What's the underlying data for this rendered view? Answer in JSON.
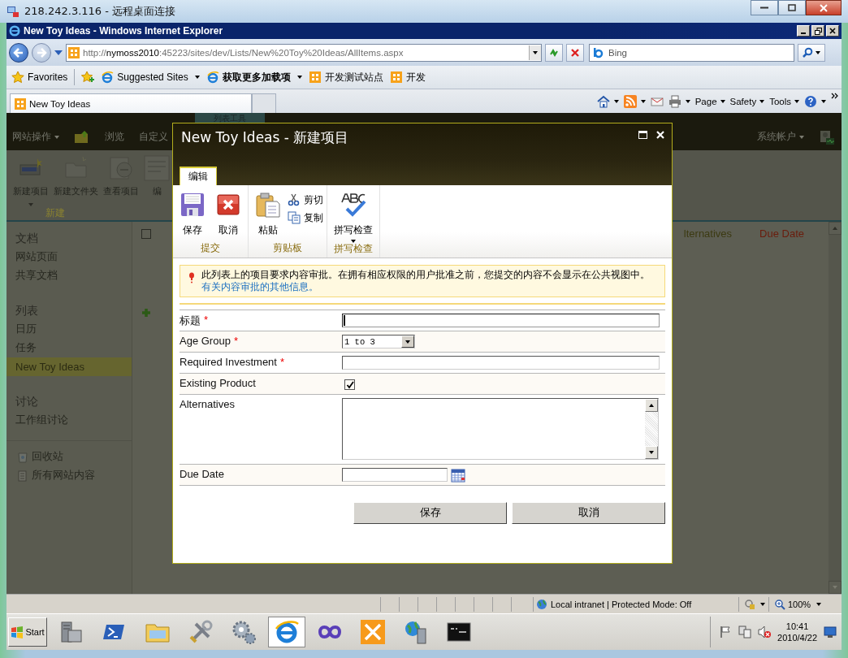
{
  "remote_window": {
    "title": "218.242.3.116 - 远程桌面连接"
  },
  "browser": {
    "title": "New Toy Ideas - Windows Internet Explorer",
    "address": {
      "prefix": "http://",
      "host": "nymoss2010",
      "path": ":45223/sites/dev/Lists/New%20Toy%20Ideas/AllItems.aspx"
    },
    "search": {
      "placeholder": "Bing"
    },
    "favorites": {
      "label": "Favorites"
    },
    "favorites_links": [
      {
        "label": "Suggested Sites",
        "kind": "ie",
        "dropdown": true,
        "bold": false
      },
      {
        "label": "获取更多加载项",
        "kind": "ie",
        "dropdown": true,
        "bold": true
      },
      {
        "label": "开发测试站点",
        "kind": "site",
        "dropdown": false,
        "bold": false
      },
      {
        "label": "开发",
        "kind": "site",
        "dropdown": false,
        "bold": false
      }
    ],
    "tabs": [
      {
        "label": "New Toy Ideas",
        "selected": true
      }
    ],
    "command_bar": [
      {
        "label": "Page"
      },
      {
        "label": "Safety"
      },
      {
        "label": "Tools"
      }
    ]
  },
  "sharepoint": {
    "contextual_tab": "列表工具",
    "site_actions": "网站操作",
    "top_links": [
      "浏览",
      "自定义"
    ],
    "user": "系统帐户",
    "ribbon": {
      "buttons": [
        "新建项目",
        "新建文件夹",
        "查看项目",
        "编"
      ],
      "group": "新建"
    },
    "select_all": {
      "checked": false
    },
    "quick_launch": [
      {
        "heading": "文档",
        "items": [
          {
            "label": "网站页面",
            "selected": false
          },
          {
            "label": "共享文档",
            "selected": false
          }
        ]
      },
      {
        "heading": "列表",
        "items": [
          {
            "label": "日历",
            "selected": false
          },
          {
            "label": "任务",
            "selected": false
          },
          {
            "label": "New Toy Ideas",
            "selected": true
          }
        ]
      },
      {
        "heading": "讨论",
        "items": [
          {
            "label": "工作组讨论",
            "selected": false
          }
        ]
      }
    ],
    "footer_links": [
      "回收站",
      "所有网站内容"
    ],
    "list_columns": [
      {
        "label": "lternatives",
        "active": false
      },
      {
        "label": "Due Date",
        "active": true
      }
    ]
  },
  "dialog": {
    "title": "New Toy Ideas - 新建项目",
    "tabs": [
      {
        "label": "编辑",
        "selected": true
      }
    ],
    "ribbon_groups": [
      {
        "label": "提交",
        "buttons": [
          {
            "label": "保存",
            "kind": "save"
          },
          {
            "label": "取消",
            "kind": "cancel"
          }
        ]
      },
      {
        "label": "剪贴板",
        "buttons": [
          {
            "label": "粘贴",
            "kind": "paste"
          },
          {
            "label": "剪切",
            "kind": "cut"
          },
          {
            "label": "复制",
            "kind": "copy"
          }
        ]
      },
      {
        "label": "拼写检查",
        "buttons": [
          {
            "label": "拼写检查",
            "kind": "spelling"
          }
        ]
      }
    ],
    "notice": {
      "text": "此列表上的项目要求内容审批。在拥有相应权限的用户批准之前，您提交的内容不会显示在公共视图中。",
      "link": "有关内容审批的其他信息。"
    },
    "fields": [
      {
        "label": "标题",
        "required_mark": "*",
        "kind": "text",
        "focused": true
      },
      {
        "label": "Age Group",
        "required_mark": "*",
        "kind": "choice",
        "value": "1 to 3"
      },
      {
        "label": "Required Investment",
        "required_mark": "*",
        "kind": "text",
        "focused": false
      },
      {
        "label": "Existing Product",
        "kind": "checkbox",
        "checked": true
      },
      {
        "label": "Alternatives",
        "kind": "textarea"
      },
      {
        "label": "Due Date",
        "kind": "date"
      }
    ],
    "buttons": [
      "保存",
      "取消"
    ]
  },
  "status_bar": {
    "zone": "Local intranet | Protected Mode: Off",
    "zoom": "100%"
  },
  "taskbar": {
    "start": "Start",
    "buttons": [
      {
        "selected": false
      },
      {
        "selected": false
      },
      {
        "selected": false
      },
      {
        "selected": false
      },
      {
        "selected": false
      },
      {
        "selected": true
      },
      {
        "selected": false
      },
      {
        "selected": false
      },
      {
        "selected": false
      },
      {
        "selected": false
      }
    ],
    "clock": {
      "time": "10:41",
      "date": "2010/4/22"
    }
  }
}
